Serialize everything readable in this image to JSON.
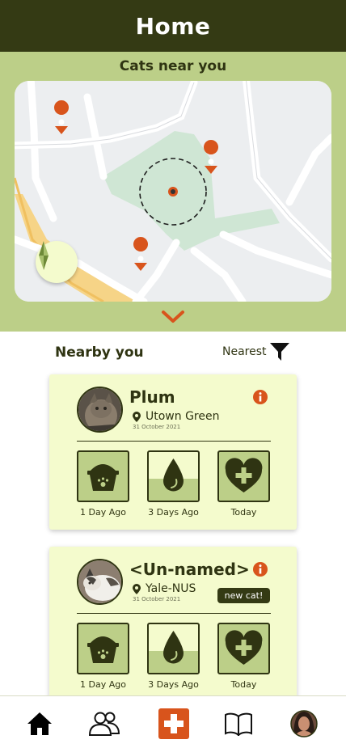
{
  "header": {
    "title": "Home"
  },
  "map": {
    "title": "Cats near you"
  },
  "nearby": {
    "title": "Nearby you",
    "sort_label": "Nearest"
  },
  "cats": [
    {
      "name": "Plum",
      "location": "Utown Green",
      "date": "31 October 2021",
      "badge": "",
      "activities": [
        {
          "icon": "food-bowl-icon",
          "label": "1 Day Ago",
          "fill": 1.0
        },
        {
          "icon": "water-drop-icon",
          "label": "3 Days Ago",
          "fill": 0.45
        },
        {
          "icon": "heart-plus-icon",
          "label": "Today",
          "fill": 1.0
        }
      ]
    },
    {
      "name": "<Un-named>",
      "location": "Yale-NUS",
      "date": "31 October 2021",
      "badge": "new cat!",
      "activities": [
        {
          "icon": "food-bowl-icon",
          "label": "1 Day Ago",
          "fill": 1.0
        },
        {
          "icon": "water-drop-icon",
          "label": "3 Days Ago",
          "fill": 0.45
        },
        {
          "icon": "heart-plus-icon",
          "label": "Today",
          "fill": 1.0
        }
      ]
    }
  ],
  "nav": {
    "items": [
      "home-icon",
      "community-icon",
      "add-icon",
      "book-icon",
      "profile-avatar"
    ]
  },
  "colors": {
    "header_bg": "#343a14",
    "map_panel_bg": "#bccf88",
    "card_bg": "#f4fbcd",
    "accent_orange": "#d8541c",
    "dark_green": "#2f3412"
  }
}
